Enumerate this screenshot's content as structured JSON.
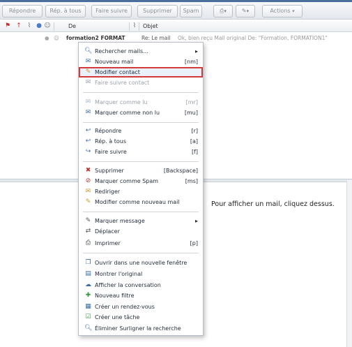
{
  "toolbar": {
    "buttons": [
      "Répondre",
      "Rép. à tous",
      "Faire suivre",
      "Supprimer",
      "Spam",
      "Actions"
    ],
    "dropdown_arrow": "▾"
  },
  "list": {
    "header_from": "De",
    "header_subject": "Objet",
    "row": {
      "from": "formation2 FORMAT",
      "subject": "Re: Le mail",
      "extra": "Ok, bien reçu   Mail original   De: \"Formation, FORMATION1\""
    }
  },
  "preview": {
    "placeholder": "Pour afficher un mail, cliquez dessus."
  },
  "menu": {
    "items": [
      {
        "label": "Rechercher mails...",
        "shortcut": "▸",
        "icon": "search-icon",
        "disabled": false
      },
      {
        "label": "Nouveau mail",
        "shortcut": "[nm]",
        "icon": "new-mail-icon",
        "disabled": false
      },
      {
        "label": "Modifier contact",
        "shortcut": "",
        "icon": "pencil-icon",
        "disabled": false
      },
      {
        "label": "Faire suivre contact",
        "shortcut": "",
        "icon": "forward-contact-icon",
        "disabled": true
      },
      {
        "label": "Marquer comme lu",
        "shortcut": "[mr]",
        "icon": "mark-read-icon",
        "disabled": true
      },
      {
        "label": "Marquer comme non lu",
        "shortcut": "[mu]",
        "icon": "mark-unread-icon",
        "disabled": false
      },
      {
        "label": "Répondre",
        "shortcut": "[r]",
        "icon": "reply-icon",
        "disabled": false
      },
      {
        "label": "Rép. à tous",
        "shortcut": "[a]",
        "icon": "reply-all-icon",
        "disabled": false
      },
      {
        "label": "Faire suivre",
        "shortcut": "[f]",
        "icon": "forward-icon",
        "disabled": false
      },
      {
        "label": "Supprimer",
        "shortcut": "[Backspace]",
        "icon": "delete-icon",
        "disabled": false
      },
      {
        "label": "Marquer comme Spam",
        "shortcut": "[ms]",
        "icon": "spam-icon",
        "disabled": false
      },
      {
        "label": "Rediriger",
        "shortcut": "",
        "icon": "redirect-icon",
        "disabled": false
      },
      {
        "label": "Modifier comme nouveau mail",
        "shortcut": "",
        "icon": "edit-as-new-icon",
        "disabled": false
      },
      {
        "label": "Marquer message",
        "shortcut": "▸",
        "icon": "tag-icon",
        "disabled": false
      },
      {
        "label": "Déplacer",
        "shortcut": "",
        "icon": "move-icon",
        "disabled": false
      },
      {
        "label": "Imprimer",
        "shortcut": "[p]",
        "icon": "print-icon",
        "disabled": false
      },
      {
        "label": "Ouvrir dans une nouvelle fenêtre",
        "shortcut": "",
        "icon": "new-window-icon",
        "disabled": false
      },
      {
        "label": "Montrer l'original",
        "shortcut": "",
        "icon": "show-original-icon",
        "disabled": false
      },
      {
        "label": "Afficher la conversation",
        "shortcut": "",
        "icon": "conversation-icon",
        "disabled": false
      },
      {
        "label": "Nouveau filtre",
        "shortcut": "",
        "icon": "filter-icon",
        "disabled": false
      },
      {
        "label": "Créer un rendez-vous",
        "shortcut": "",
        "icon": "calendar-icon",
        "disabled": false
      },
      {
        "label": "Créer une tâche",
        "shortcut": "",
        "icon": "task-icon",
        "disabled": false
      },
      {
        "label": "Éliminer Surligner la recherche",
        "shortcut": "",
        "icon": "clear-highlight-icon",
        "disabled": false
      }
    ]
  }
}
